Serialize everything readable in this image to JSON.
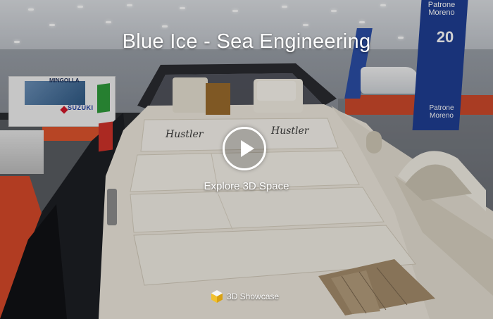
{
  "showcase": {
    "title": "Blue Ice - Sea Engineering",
    "explore_label": "Explore 3D Space",
    "brand_label": "3D Showcase"
  },
  "scene": {
    "booth_name": "MINGOLLA",
    "booth_sponsor": "SUZUKI",
    "banner_top": "Patrone Moreno",
    "banner_mid": "20",
    "banner_bottom": "Patrone Moreno",
    "hull_script": "Hustler"
  },
  "colors": {
    "title_text": "#ffffff",
    "play_button": "#ffffff",
    "red_carpet": "#d84a2a",
    "banner_blue": "#1f3f94"
  },
  "icons": {
    "play": "play-icon",
    "brand": "matterport-cube-icon"
  }
}
